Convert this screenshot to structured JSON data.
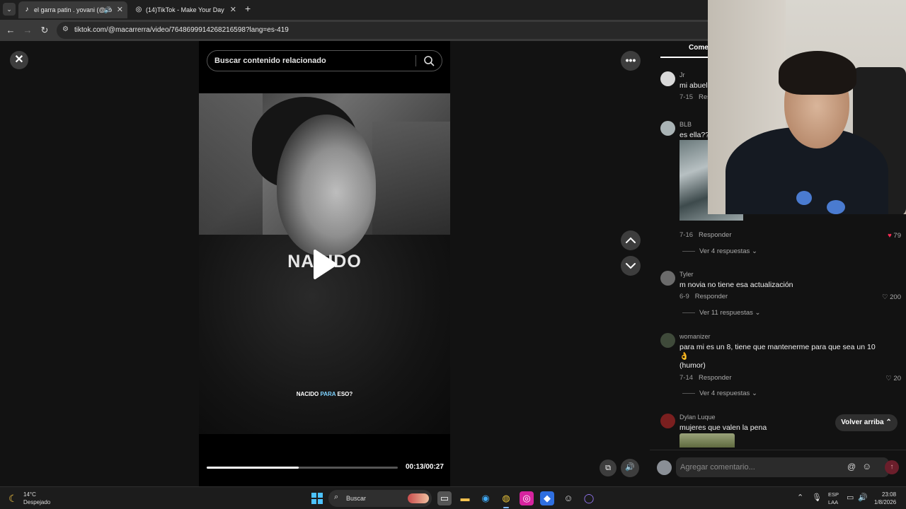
{
  "browser": {
    "tabs": [
      {
        "title": "el garra patin . yovani (@yo",
        "active": true
      },
      {
        "title": "(14)TikTok - Make Your Day",
        "active": false
      }
    ],
    "url": "tiktok.com/@macarrerra/video/7648699914268216598?lang=es-419"
  },
  "player": {
    "search_placeholder": "Buscar contenido relacionado",
    "overlay_text": "NACIDO",
    "caption_pre": "NACIDO ",
    "caption_highlight": "PARA",
    "caption_post": " ESO?",
    "time": "00:13/00:27",
    "progress": 0.48
  },
  "comments": {
    "tab_label": "Come",
    "items": [
      {
        "user": "Jr",
        "text": "mi abuela",
        "date": "7-15",
        "reply": "Resp"
      },
      {
        "user": "BLB",
        "text": "es ella??",
        "date": "7-16",
        "reply": "Responder",
        "likes": "79",
        "liked": true,
        "replies": "Ver 4 respuestas"
      },
      {
        "user": "Tyler",
        "text": "m novia no tiene esa actualización",
        "date": "6-9",
        "reply": "Responder",
        "likes": "200",
        "replies": "Ver 11 respuestas"
      },
      {
        "user": "womanizer",
        "text": "para mi es un 8, tiene que mantenerme para que sea un 10",
        "text2": "👌",
        "text3": "(humor)",
        "date": "7-14",
        "reply": "Responder",
        "likes": "20",
        "replies": "Ver 4 respuestas"
      },
      {
        "user": "Dylan Luque",
        "text": "mujeres que valen la pena"
      }
    ],
    "back_to_top": "Volver arriba",
    "composer_placeholder": "Agregar comentario..."
  },
  "taskbar": {
    "temp": "14°C",
    "weather": "Despejado",
    "search_label": "Buscar",
    "lang1": "ESP",
    "lang2": "LAA",
    "time": "23:08",
    "date": "1/8/2026"
  }
}
